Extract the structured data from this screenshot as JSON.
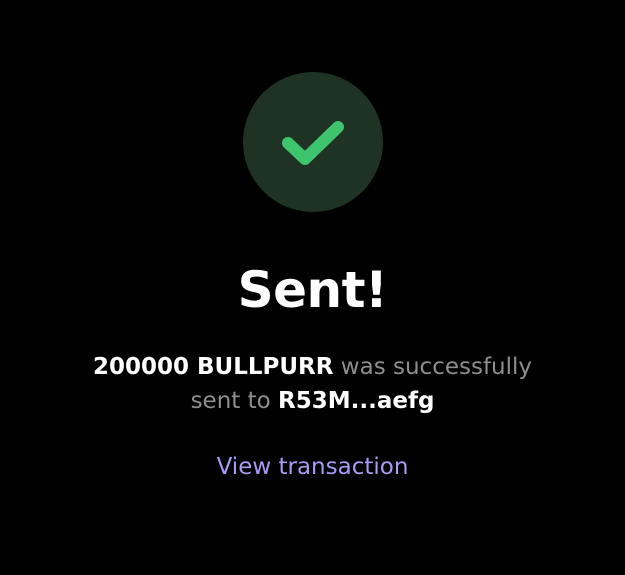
{
  "status": {
    "title": "Sent!",
    "icon": "check-icon",
    "icon_color": "#3ec46d",
    "circle_color": "#1f3324"
  },
  "message": {
    "amount": "200000 BULLPURR",
    "text_middle": "was successfully",
    "text_to": "sent to",
    "recipient": "R53M...aefg"
  },
  "actions": {
    "view_transaction_label": "View transaction",
    "link_color": "#a99af6"
  }
}
